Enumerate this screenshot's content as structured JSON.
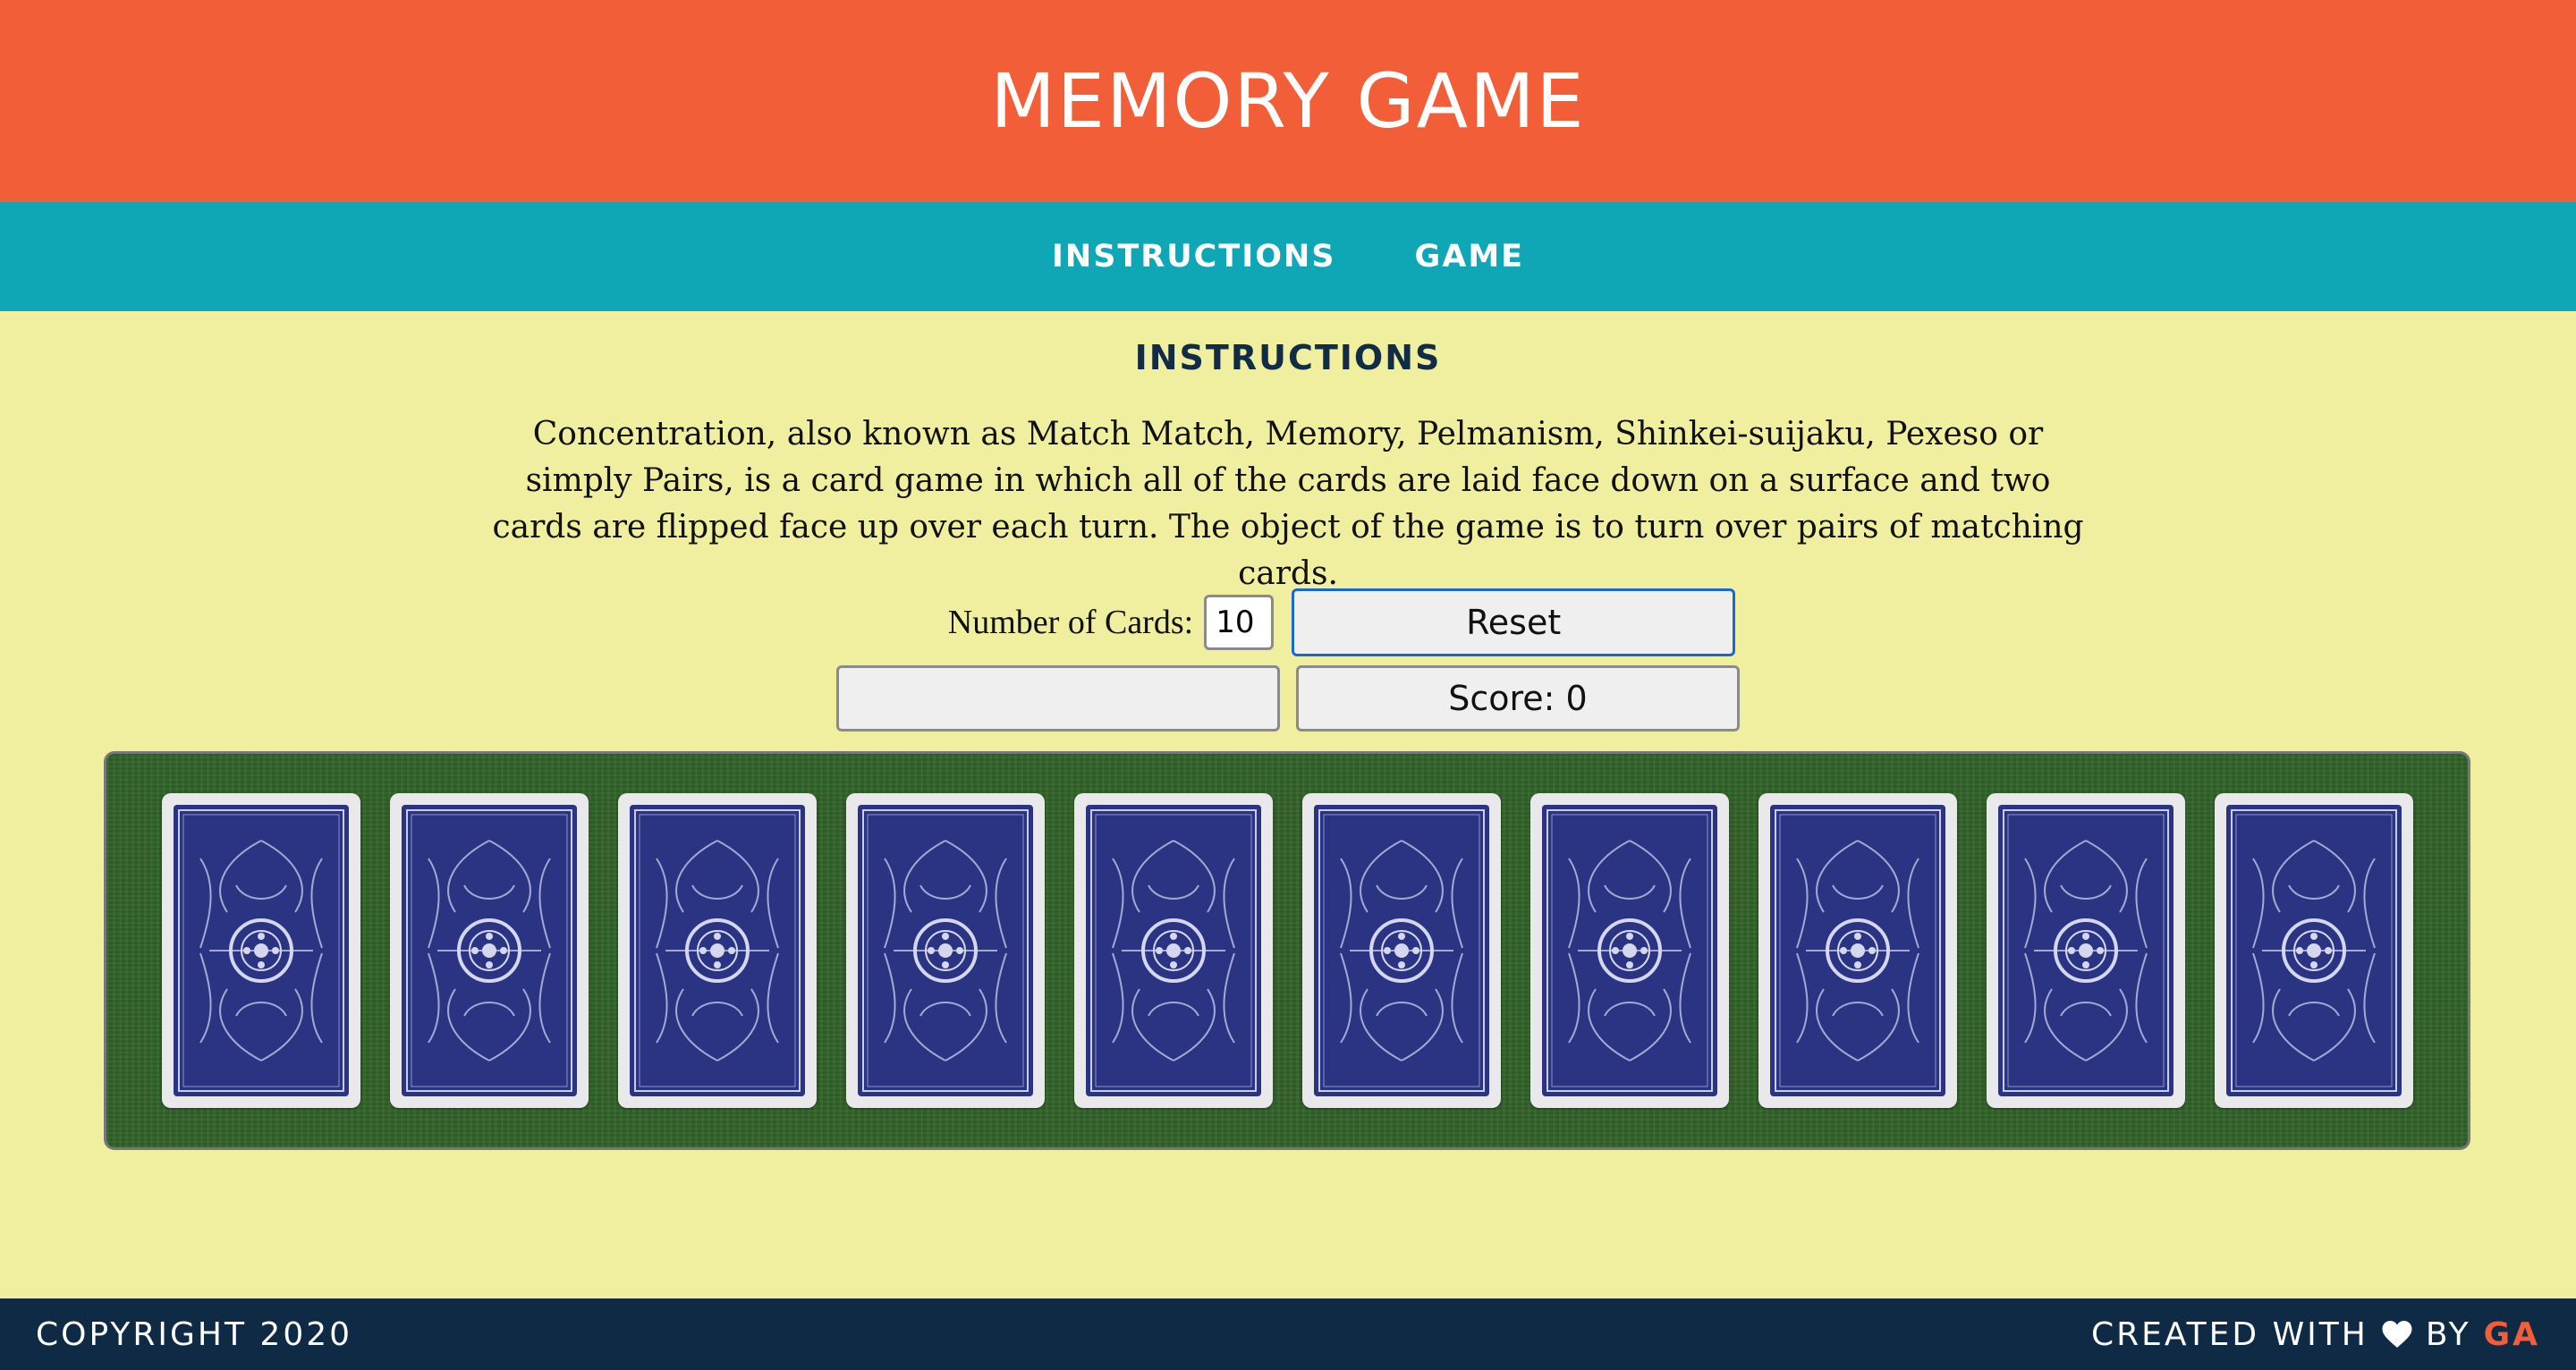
{
  "header": {
    "title": "MEMORY GAME"
  },
  "nav": {
    "items": [
      {
        "label": "INSTRUCTIONS"
      },
      {
        "label": "GAME"
      }
    ]
  },
  "instructions": {
    "heading": "INSTRUCTIONS",
    "text": "Concentration, also known as Match Match, Memory, Pelmanism, Shinkei-suijaku, Pexeso or simply Pairs, is a card game in which all of the cards are laid face down on a surface and two cards are flipped face up over each turn. The object of the game is to turn over pairs of matching cards."
  },
  "controls": {
    "num_cards_label": "Number of Cards:",
    "num_cards_value": "10",
    "reset_label": "Reset",
    "status_text": "",
    "score_text": "Score: 0"
  },
  "board": {
    "card_count": 10,
    "card_back_color": "#2a3483",
    "felt_color": "#32642a"
  },
  "footer": {
    "copyright": "COPYRIGHT 2020",
    "created_with": "CREATED WITH",
    "by": "BY",
    "author": "GA",
    "icon": "heart-icon"
  },
  "colors": {
    "header_bg": "#f15e38",
    "nav_bg": "#0fa7b5",
    "page_bg": "#f0ee9f",
    "footer_bg": "#0e2a45"
  }
}
